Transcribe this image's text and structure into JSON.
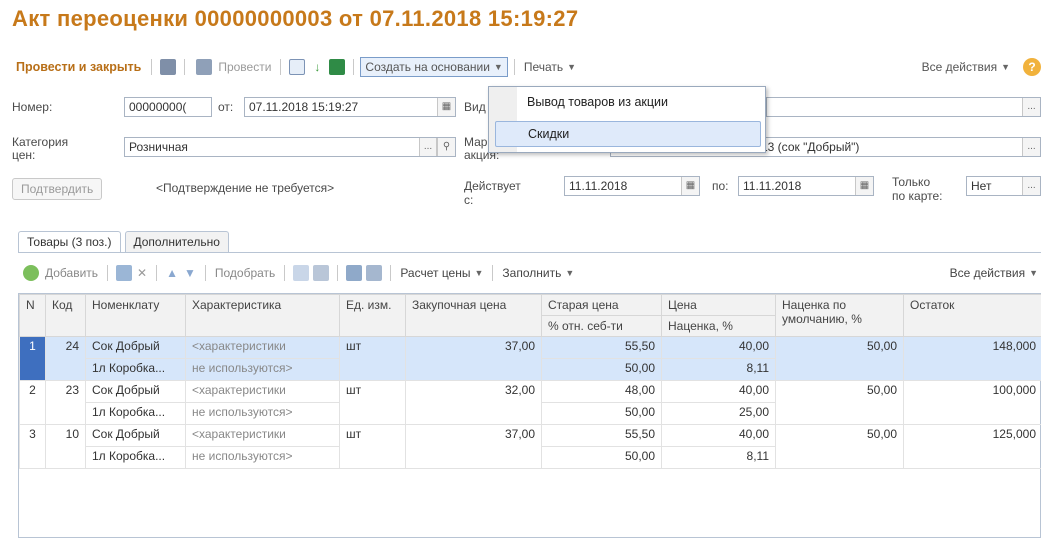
{
  "title": "Акт переоценки 00000000003 от 07.11.2018 15:19:27",
  "toolbar": {
    "post_and_close": "Провести и закрыть",
    "post": "Провести",
    "create_based_on": "Создать на основании",
    "print": "Печать",
    "all_actions": "Все действия",
    "help": "?"
  },
  "form": {
    "number_label": "Номер:",
    "number_value": "00000000(",
    "from_label": "от:",
    "date_value": "07.11.2018 15:19:27",
    "type_label": "Вид",
    "category_label_1": "Категория",
    "category_label_2": "цен:",
    "category_value": "Розничная",
    "promo_label_1": "Мар",
    "promo_label_2": "акция:",
    "promo_value": "13 (сок \"Добрый\")",
    "confirm_button": "Подтвердить",
    "confirm_status": "<Подтверждение не требуется>",
    "valid_label_1": "Действует",
    "valid_label_2": "с:",
    "valid_from": "11.11.2018",
    "to_label": "по:",
    "valid_to": "11.11.2018",
    "card_only_label_1": "Только",
    "card_only_label_2": "по карте:",
    "card_only_value": "Нет"
  },
  "tabs": [
    "Товары (3 поз.)",
    "Дополнительно"
  ],
  "table_toolbar": {
    "add": "Добавить",
    "pick": "Подобрать",
    "calc_price": "Расчет цены",
    "fill": "Заполнить",
    "all_actions": "Все действия"
  },
  "table": {
    "headers": {
      "n": "N",
      "code": "Код",
      "item": "Номенклату",
      "characteristic": "Характеристика",
      "unit": "Ед. изм.",
      "purchase_price": "Закупочная цена",
      "old_price": "Старая цена",
      "old_price_sub": "% отн. себ-ти",
      "price": "Цена",
      "price_sub": "Наценка, %",
      "default_markup": "Наценка по умолчанию, %",
      "stock": "Остаток"
    },
    "rows": [
      {
        "n": "1",
        "code": "24",
        "item_1": "Сок Добрый",
        "item_2": "1л Коробка...",
        "char_1": "<характеристики",
        "char_2": "не используются>",
        "unit": "шт",
        "purchase": "37,00",
        "old_price": "55,50",
        "pct_cost": "50,00",
        "price": "40,00",
        "markup": "8,11",
        "default_markup": "50,00",
        "stock": "148,000"
      },
      {
        "n": "2",
        "code": "23",
        "item_1": "Сок Добрый",
        "item_2": "1л Коробка...",
        "char_1": "<характеристики",
        "char_2": "не используются>",
        "unit": "шт",
        "purchase": "32,00",
        "old_price": "48,00",
        "pct_cost": "50,00",
        "price": "40,00",
        "markup": "25,00",
        "default_markup": "50,00",
        "stock": "100,000"
      },
      {
        "n": "3",
        "code": "10",
        "item_1": "Сок Добрый",
        "item_2": "1л Коробка...",
        "char_1": "<характеристики",
        "char_2": "не используются>",
        "unit": "шт",
        "purchase": "37,00",
        "old_price": "55,50",
        "pct_cost": "50,00",
        "price": "40,00",
        "markup": "8,11",
        "default_markup": "50,00",
        "stock": "125,000"
      }
    ]
  },
  "dropdown": {
    "items": [
      "Вывод товаров из акции",
      "Скидки"
    ],
    "active_index": 1
  },
  "colors": {
    "title": "#c7791a",
    "selected_row": "#d6e6fa",
    "selected_number": "#3e6fbf"
  }
}
